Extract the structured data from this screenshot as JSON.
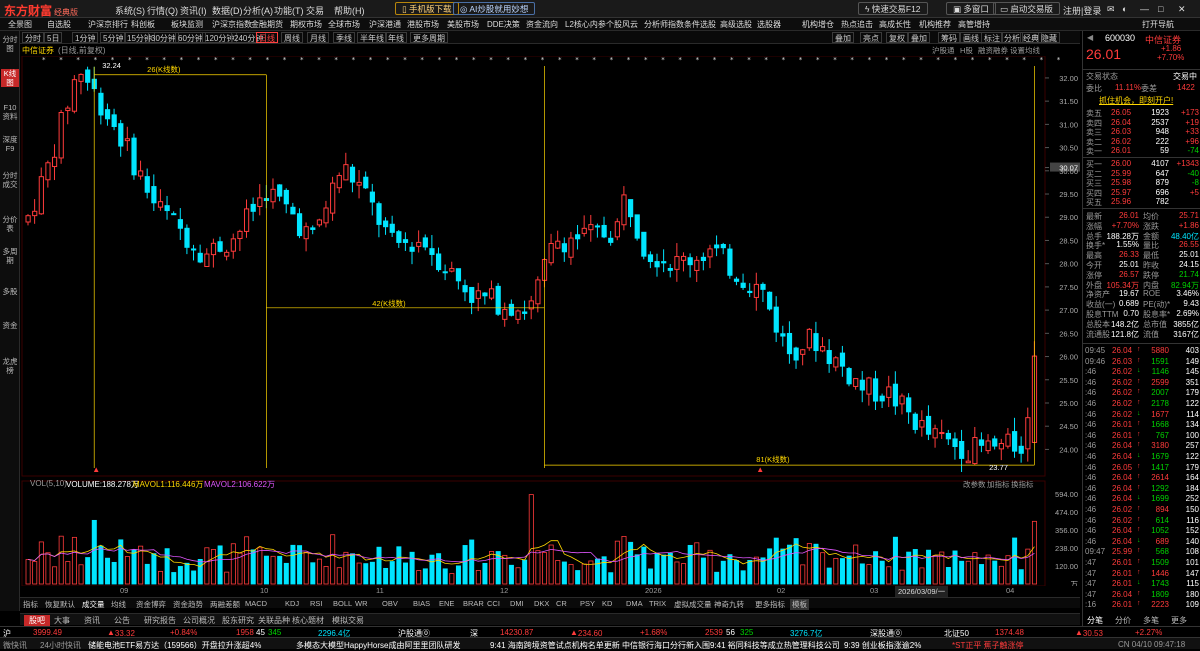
{
  "app": {
    "logo": "东方财富",
    "edition": "经典版",
    "menu": [
      "系统(S)",
      "行情(Q)",
      "资讯(I)",
      "数据(D)",
      "分析(A)",
      "功能(T)",
      "交易",
      "帮助(H)"
    ],
    "buttons": {
      "download": "手机版下载",
      "ai": "AI炒股就用妙想",
      "quick": "快速交易F12",
      "multi": "多窗口",
      "restore": "启动交易版",
      "login": "注册|登录"
    }
  },
  "nav": [
    "全景图",
    "自选股",
    "沪深京排行",
    "科创板",
    "板块监测",
    "沪深京指数",
    "金融期货",
    "期权市场",
    "全球市场",
    "沪深港通",
    "港股市场",
    "美股市场",
    "DDE决策",
    "资金流向",
    "L2核心内参",
    "个股风云",
    "分析师指数",
    "条件选股",
    "高级选股",
    "选股器",
    "机构增仓",
    "热点追击",
    "高成长性",
    "机构推荐",
    "高管增持",
    "打开导航"
  ],
  "periods": [
    "分时",
    "5日",
    "1分钟",
    "5分钟",
    "15分钟",
    "30分钟",
    "60分钟",
    "120分钟",
    "240分钟",
    "日线",
    "周线",
    "月线",
    "季线",
    "半年线",
    "年线",
    "更多周期"
  ],
  "period_active": "日线",
  "period_right": [
    "叠加",
    "亮点",
    "复权",
    "叠加",
    "筹码",
    "画线",
    "标注",
    "分析",
    "经典",
    "隐藏"
  ],
  "sidebar": [
    "分时图",
    "K线图",
    "F10资料",
    "深度F9",
    "分时成交",
    "分价表",
    "多周期",
    "多股",
    "资金",
    "龙虎榜"
  ],
  "sidebar_active": "K线图",
  "chart": {
    "name": "中信证券",
    "adj": "(日线,前复权)",
    "tools": [
      "沪股通",
      "H股",
      "融资融券",
      "设置均线"
    ],
    "high_label": "32.24",
    "low_label": "23.77",
    "ann1": "26(K线数)",
    "ann2": "42(K线数)",
    "ann3": "81(K线数)",
    "price_axis": [
      "32.00",
      "31.50",
      "31.00",
      "30.50",
      "30.07",
      "30.00",
      "29.50",
      "29.00",
      "28.50",
      "28.00",
      "27.50",
      "27.00",
      "26.50",
      "26.00",
      "25.50",
      "25.00",
      "24.50",
      "24.00"
    ],
    "vol_axis": [
      "594.00",
      "474.00",
      "356.00",
      "238.00",
      "120.00",
      "万"
    ],
    "vol_hdr": {
      "label": "VOL(5,10)",
      "volume": "VOLUME:188.278万",
      "mavol1": "MAVOL1:116.446万",
      "mavol2": "MAVOL2:106.622万"
    },
    "vol_tools": [
      "改参数",
      "加指标",
      "换指标"
    ],
    "x_labels": [
      "09",
      "10",
      "11",
      "12",
      "2026",
      "02",
      "03",
      "04"
    ],
    "cursor_date": "2026/03/09/一"
  },
  "indicators": [
    "指标",
    "恢复默认",
    "成交量",
    "均线",
    "资金博弈",
    "资金趋势",
    "两融差额",
    "MACD",
    "KDJ",
    "RSI",
    "BOLL",
    "WR",
    "OBV",
    "BIAS",
    "ENE",
    "BRAR",
    "CCI",
    "DMI",
    "DKX",
    "CR",
    "PSY",
    "KD",
    "DMA",
    "TRIX",
    "虚拟成交量",
    "神奇九转",
    "更多指标",
    "模板"
  ],
  "bottom_tabs": [
    "股吧",
    "大事",
    "资讯",
    "公告",
    "研究报告",
    "公司概况",
    "股东研究",
    "关联品种",
    "核心题材",
    "模拟交易"
  ],
  "index_bar": {
    "sh": "沪",
    "sh_val": "3999.49",
    "sh_chg": "33.32",
    "sh_pct": "+0.84%",
    "sh_ud": "1958",
    "sh_f": "45",
    "sh_u": "345",
    "sh_amt": "2296.4亿",
    "hgt": "沪股通⓪",
    "sz": "深",
    "sz_val": "14230.87",
    "sz_chg": "234.60",
    "sz_pct": "+1.68%",
    "sz_ud": "2539",
    "sz_f": "56",
    "sz_u": "325",
    "sz_amt": "3276.7亿",
    "sgt": "深股通⓪",
    "bj": "北证50",
    "bj_val": "1374.48",
    "bj_chg": "30.53",
    "bj_pct": "+2.27%"
  },
  "news_bar": {
    "items": [
      "储能电池ETF易方达（159566）开盘拉升涨超4%",
      "多模态大模型HappyHorse成由阿里里团队研发",
      "9:41 海南跨境资管试点机构名单更新 中信银行海口分行新入围",
      "9:41 裕同科技等成立热管理科技公司",
      "9:39 创业板指涨逾2%"
    ],
    "ticker": "*ST正平 蕉子触涨停",
    "time": "CN 04/10 09:47:18",
    "label": "24小时快讯",
    "icon": "微快讯"
  },
  "quote": {
    "code": "600030",
    "name": "中信证券",
    "price": "26.01",
    "chg": "+1.86",
    "pct": "+7.70%",
    "status_label": "交易状态",
    "status": "交易中",
    "weibi_l": "委比",
    "weibi": "11.11%",
    "weicha_l": "委差",
    "weicha": "1422",
    "ad": "抓住机会，即刻开户!",
    "asks": [
      [
        "卖五",
        "26.05",
        "1923",
        "+173"
      ],
      [
        "卖四",
        "26.04",
        "2537",
        "+19"
      ],
      [
        "卖三",
        "26.03",
        "948",
        "+33"
      ],
      [
        "卖二",
        "26.02",
        "222",
        "+96"
      ],
      [
        "卖一",
        "26.01",
        "59",
        "-74"
      ]
    ],
    "bids": [
      [
        "买一",
        "26.00",
        "4107",
        "+1343"
      ],
      [
        "买二",
        "25.99",
        "647",
        "-40"
      ],
      [
        "买三",
        "25.98",
        "879",
        "-8"
      ],
      [
        "买四",
        "25.97",
        "696",
        "+5"
      ],
      [
        "买五",
        "25.96",
        "782",
        ""
      ]
    ],
    "stats": [
      [
        "最新",
        "26.01",
        "均价",
        "25.71"
      ],
      [
        "涨幅",
        "+7.70%",
        "涨跌",
        "+1.86"
      ],
      [
        "总手",
        "188.28万",
        "金额",
        "48.40亿"
      ],
      [
        "换手*",
        "1.55%",
        "量比",
        "26.55"
      ],
      [
        "最高",
        "26.33",
        "最低",
        "25.01"
      ],
      [
        "今开",
        "25.01",
        "昨收",
        "24.15"
      ],
      [
        "涨停",
        "26.57",
        "跌停",
        "21.74"
      ],
      [
        "外盘",
        "105.34万",
        "内盘",
        "82.94万"
      ],
      [
        "净资产",
        "19.67",
        "ROE",
        "3.46%"
      ],
      [
        "收益(一)",
        "0.689",
        "PE(动)*",
        "9.43"
      ],
      [
        "股息TTM",
        "0.70",
        "股息率*",
        "2.69%"
      ],
      [
        "总股本",
        "148.2亿",
        "总市值",
        "3855亿"
      ],
      [
        "流通股",
        "121.8亿",
        "流值",
        "3167亿"
      ]
    ],
    "ticks": [
      [
        "09:45",
        "26.04",
        "5880",
        "403"
      ],
      [
        "09:46",
        "26.03",
        "1591",
        "149"
      ],
      [
        ":46",
        "26.02",
        "1146",
        "145"
      ],
      [
        ":46",
        "26.02",
        "2599",
        "351"
      ],
      [
        ":46",
        "26.02",
        "2007",
        "179"
      ],
      [
        ":46",
        "26.02",
        "2178",
        "122"
      ],
      [
        ":46",
        "26.02",
        "1677",
        "114"
      ],
      [
        ":46",
        "26.01",
        "1668",
        "134"
      ],
      [
        ":46",
        "26.01",
        "767",
        "100"
      ],
      [
        ":46",
        "26.04",
        "3180",
        "257"
      ],
      [
        ":46",
        "26.04",
        "1679",
        "122"
      ],
      [
        ":46",
        "26.05",
        "1417",
        "179"
      ],
      [
        ":46",
        "26.04",
        "2614",
        "164"
      ],
      [
        ":46",
        "26.04",
        "1292",
        "184"
      ],
      [
        ":46",
        "26.04",
        "1699",
        "252"
      ],
      [
        ":46",
        "26.02",
        "894",
        "150"
      ],
      [
        ":46",
        "26.02",
        "614",
        "116"
      ],
      [
        ":46",
        "26.04",
        "1052",
        "152"
      ],
      [
        ":46",
        "26.04",
        "689",
        "140"
      ],
      [
        "09:47",
        "25.99",
        "568",
        "108"
      ],
      [
        ":47",
        "26.01",
        "1509",
        "101"
      ],
      [
        ":47",
        "26.01",
        "1446",
        "147"
      ],
      [
        ":47",
        "26.01",
        "1743",
        "115"
      ],
      [
        ":47",
        "26.04",
        "1809",
        "180"
      ],
      [
        ":16",
        "26.01",
        "2223",
        "109"
      ]
    ],
    "tabs": [
      "分笔",
      "分价",
      "多笔",
      "更多"
    ]
  },
  "colors": {
    "up": "#ff3b3b",
    "down": "#00e5ff",
    "ma1": "#ffd700",
    "ma2": "#e056fd",
    "grid": "#3a0000"
  }
}
